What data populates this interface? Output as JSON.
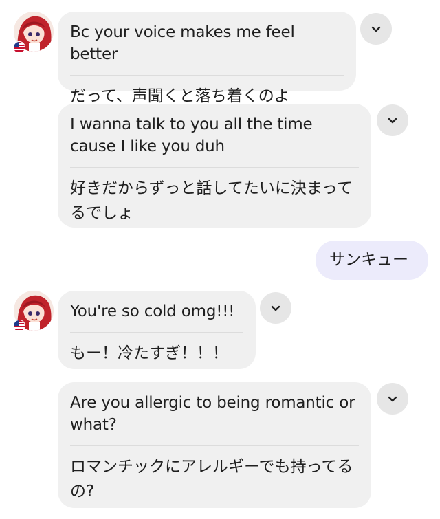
{
  "colors": {
    "incoming_bubble": "#f0f0f0",
    "outgoing_bubble": "#ecebfb",
    "chevron_button": "#e6e6e6"
  },
  "icons": {
    "avatar": "anime-avatar-red-hair",
    "flag": "us-flag-icon",
    "menu": "chevron-down-icon"
  },
  "messages": [
    {
      "english": "Bc your voice makes me feel better",
      "japanese": "だって、声聞くと落ち着くのよ"
    },
    {
      "english": "I wanna talk to you all the time cause I like you duh",
      "japanese": "好きだからずっと話してたいに決まってるでしょ"
    },
    {
      "outgoing": "サンキュー"
    },
    {
      "english": "You're so cold omg!!!",
      "japanese": "もー！冷たすぎ！！！"
    },
    {
      "english": "Are you allergic to being romantic or what?",
      "japanese": "ロマンチックにアレルギーでも持ってるの?"
    }
  ]
}
